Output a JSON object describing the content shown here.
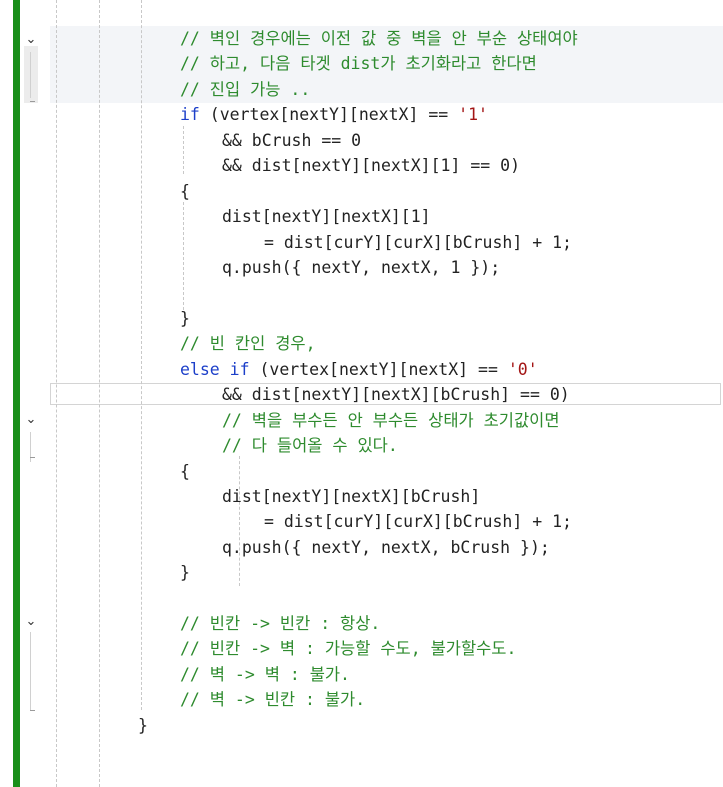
{
  "editor": {
    "lines": [
      "// 벽인 경우에는 이전 값 중 벽을 안 부순 상태여야",
      "// 하고, 다음 타겟 dist가 초기화라고 한다면",
      "// 진입 가능 ..",
      {
        "kw": "if",
        "rest": " (vertex[nextY][nextX] == ",
        "str": "'1'"
      },
      "&& bCrush == 0",
      "&& dist[nextY][nextX][1] == 0)",
      "{",
      "dist[nextY][nextX][1]",
      "= dist[curY][curX][bCrush] + 1;",
      "q.push({ nextY, nextX, 1 });",
      "}",
      "// 빈 칸인 경우,",
      {
        "kw": "else if",
        "rest": " (vertex[nextY][nextX] == ",
        "str": "'0'"
      },
      "&& dist[nextY][nextX][bCrush] == 0)",
      "// 벽을 부수든 안 부수든 상태가 초기값이면",
      "// 다 들어올 수 있다.",
      "{",
      "dist[nextY][nextX][bCrush]",
      "= dist[curY][curX][bCrush] + 1;",
      "q.push({ nextY, nextX, bCrush });",
      "}",
      "// 빈칸 -> 빈칸 : 항상.",
      "// 빈칸 -> 벽 : 가능할 수도, 불가할수도.",
      "// 벽 -> 벽 : 불가.",
      "// 벽 -> 빈칸 : 불가.",
      "}"
    ]
  },
  "colors": {
    "gutter_bar": "#1a8f1a",
    "comment": "#2e8b2e",
    "keyword": "#1c3fc9",
    "string": "#a31515",
    "variable": "#2b6fa8"
  }
}
